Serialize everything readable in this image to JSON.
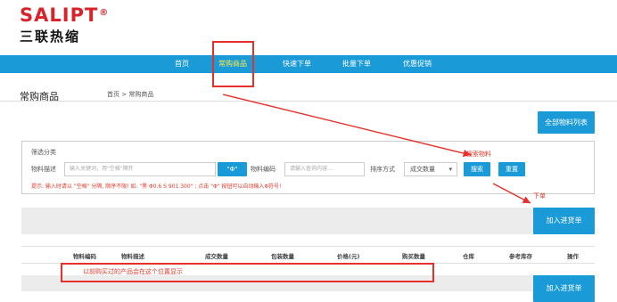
{
  "brand": {
    "name_en": "SALIPT",
    "reg_mark": "®",
    "name_cn": "三联热缩"
  },
  "nav": {
    "items": [
      "首页",
      "常购商品",
      "快速下单",
      "批量下单",
      "优惠促销"
    ],
    "active_index": 1
  },
  "page": {
    "title": "常购商品",
    "breadcrumb": "首页 > 常购商品"
  },
  "actions": {
    "all_materials": "全部物料列表",
    "add_to_cart_top": "加入进货单",
    "add_to_cart_bottom": "加入进货单"
  },
  "filter": {
    "section_label": "筛选分类",
    "desc_label": "物料描述",
    "desc_placeholder": "输入关键词，用\"空格\"隔开",
    "phi_button": "\"Φ\"",
    "code_label": "物料编码",
    "code_placeholder": "请输入查询内容....",
    "sort_label": "排序方式",
    "sort_value": "成交数量",
    "search_button": "搜索",
    "reset_button": "重置",
    "hint": "提示: 输入时请以 \"空格\" 分隔, 顺序不限! 如: \"黑 Φ0.6 S 901 300\" ; 点击 \"Φ\" 按钮可以自动输入Φ符号!"
  },
  "table": {
    "headers": [
      "物料编码",
      "物料描述",
      "成交数量",
      "包装数量",
      "价格(元)",
      "购买数量",
      "仓库",
      "参考库存",
      "操作"
    ]
  },
  "annotations": {
    "search_materials": "搜索物料",
    "place_order": "下单",
    "history_note": "以前购买过的产品会在这个位置显示"
  },
  "colors": {
    "brand_red": "#d9232a",
    "nav_blue": "#1a9ad6",
    "nav_active": "#ffe94a",
    "annotation_red": "#e6302b"
  }
}
